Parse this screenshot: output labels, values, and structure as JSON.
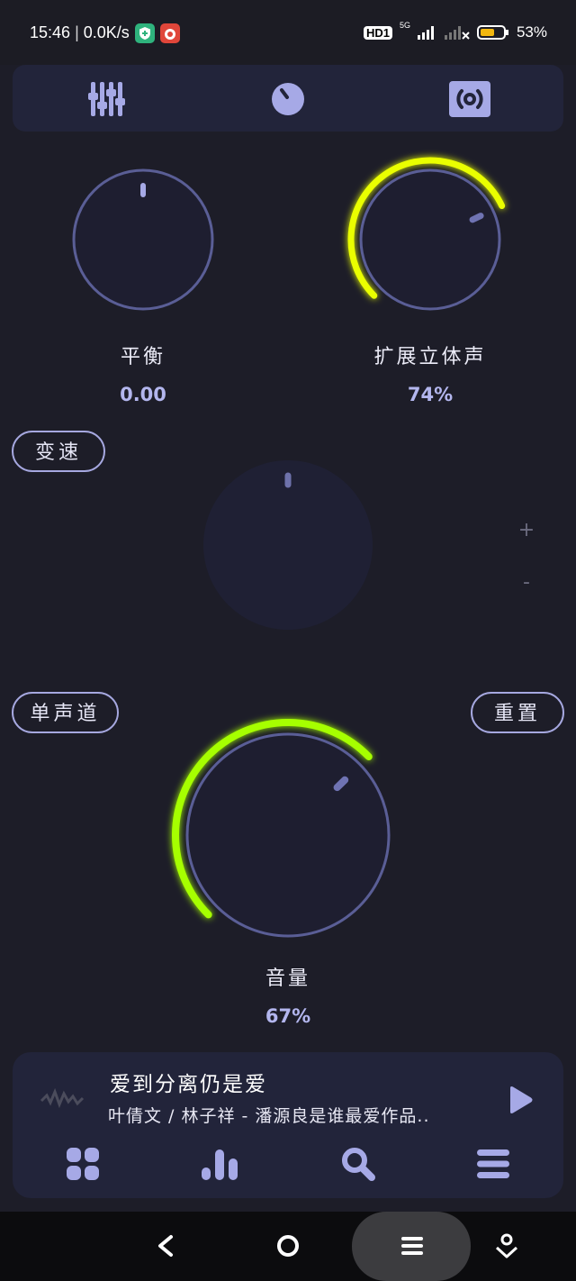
{
  "status_bar": {
    "time": "15:46",
    "net_speed": "0.0K/s",
    "hd_label": "HD1",
    "network": "5G",
    "battery": "53%"
  },
  "top_tabs": [
    {
      "icon": "equalizer-sliders-icon"
    },
    {
      "icon": "knob-icon"
    },
    {
      "icon": "surround-speaker-icon"
    }
  ],
  "knobs": {
    "balance": {
      "label": "平衡",
      "value": "0.00"
    },
    "stereo": {
      "label": "扩展立体声",
      "value": "74%",
      "level": 0.74,
      "accent": "#eaff00"
    },
    "volume": {
      "label": "音量",
      "value": "67%",
      "level": 0.67,
      "accent": "#a6ff00"
    }
  },
  "buttons": {
    "speed": "变速",
    "mono": "单声道",
    "reset": "重置",
    "plus": "+",
    "minus": "-"
  },
  "player": {
    "title": "爱到分离仍是爱",
    "artist": "叶倩文 / 林子祥 - 潘源良是谁最爱作品.."
  },
  "bottom_nav": [
    {
      "icon": "grid-icon"
    },
    {
      "icon": "bar-chart-icon"
    },
    {
      "icon": "search-icon"
    },
    {
      "icon": "menu-icon"
    }
  ],
  "colors": {
    "background": "#1d1d28",
    "panel": "#22243a",
    "knob_ring": "#5a5e96",
    "icon_tint": "#a6a9e6"
  }
}
